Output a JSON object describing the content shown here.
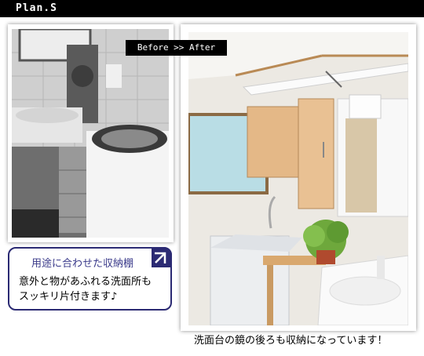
{
  "header": {
    "title": "Plan.S"
  },
  "before_after_label": "Before >> After",
  "bubble": {
    "title": "用途に合わせた収納棚",
    "line1": "意外と物があふれる洗面所も",
    "line2": "スッキリ片付きます♪"
  },
  "caption": "洗面台の鏡の後ろも収納になっています！",
  "colors": {
    "header_bg": "#000000",
    "bubble_border": "#2b2a73",
    "bubble_title": "#3a3a8a"
  },
  "photos": {
    "before": {
      "description_icon": "before-photo",
      "style": "grayscale"
    },
    "after": {
      "description_icon": "after-photo",
      "style": "color"
    }
  }
}
